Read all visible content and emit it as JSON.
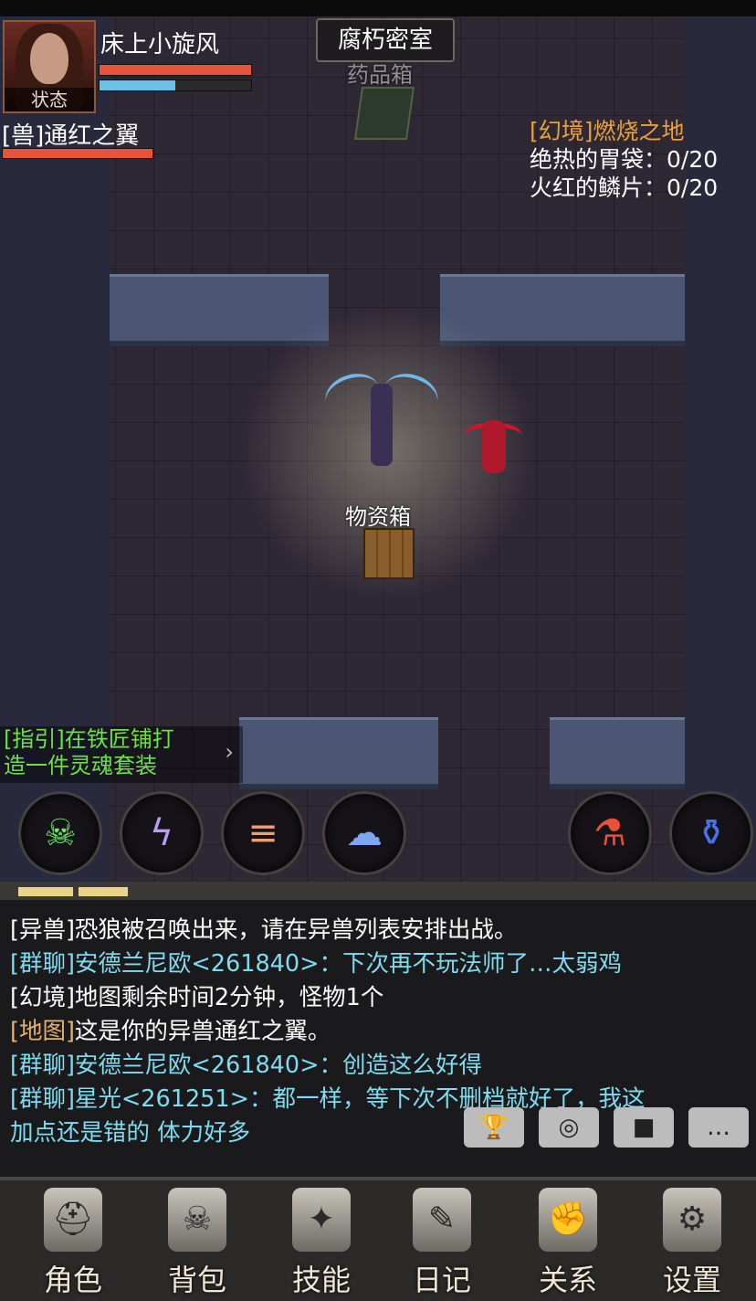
{
  "map": {
    "title": "腐朽密室",
    "chest_label": "药品箱",
    "crate_label": "物资箱"
  },
  "player": {
    "name": "床上小旋风",
    "status_label": "状态",
    "hp_ratio": 1.0,
    "mp_ratio": 0.5
  },
  "pet": {
    "name": "[兽]通红之翼",
    "hp_ratio": 1.0
  },
  "quest": {
    "title": "[幻境]燃烧之地",
    "items": [
      {
        "name": "绝热的胃袋",
        "sep": "：",
        "progress": "0/20"
      },
      {
        "name": "火红的鳞片",
        "sep": "：",
        "progress": "0/20"
      }
    ]
  },
  "guide": {
    "line1": "[指引]在铁匠铺打",
    "line2": "造一件灵魂套装",
    "chevron": "›"
  },
  "skills": [
    {
      "icon": "poison-skull-icon",
      "glyph": "☠"
    },
    {
      "icon": "lightning-orb-icon",
      "glyph": "ϟ"
    },
    {
      "icon": "triple-slash-icon",
      "glyph": "≡"
    },
    {
      "icon": "storm-cloud-icon",
      "glyph": "☁"
    }
  ],
  "potions": [
    {
      "icon": "red-potion-icon",
      "glyph": "⚗"
    },
    {
      "icon": "blue-potion-icon",
      "glyph": "⚱"
    }
  ],
  "chat": {
    "lines": [
      {
        "tag": "[异兽]",
        "text": "恐狼被召唤出来，请在异兽列表安排出战。",
        "color": "#ffffff",
        "tag_color": "#ffffff"
      },
      {
        "tag": "[群聊]",
        "text": "安德兰尼欧<261840>：下次再不玩法师了…太弱鸡",
        "color": "#7fdcf0",
        "tag_color": "#7fdcf0"
      },
      {
        "tag": "[幻境]",
        "text": "地图剩余时间2分钟，怪物1个",
        "color": "#ffffff",
        "tag_color": "#ffffff"
      },
      {
        "tag": "[地图]",
        "text": "这是你的异兽通红之翼。",
        "color": "#ffffff",
        "tag_color": "#e6b070"
      },
      {
        "tag": "[群聊]",
        "text": "安德兰尼欧<261840>：创造这么好得",
        "color": "#7fdcf0",
        "tag_color": "#7fdcf0"
      },
      {
        "tag": "[群聊]",
        "text": "星光<261251>：都一样，等下次不删档就好了，我这",
        "color": "#7fdcf0",
        "tag_color": "#7fdcf0"
      },
      {
        "tag": "",
        "text": "加点还是错的  体力好多",
        "color": "#7fdcf0",
        "tag_color": "#7fdcf0"
      }
    ]
  },
  "chat_buttons": [
    {
      "icon": "trophy-icon",
      "glyph": "🏆"
    },
    {
      "icon": "compass-icon",
      "glyph": "◎"
    },
    {
      "icon": "stop-icon",
      "glyph": "■"
    },
    {
      "icon": "chat-bubble-icon",
      "glyph": "…"
    }
  ],
  "nav": [
    {
      "label": "角色",
      "icon": "helmet-icon",
      "glyph": "⛑"
    },
    {
      "label": "背包",
      "icon": "backpack-icon",
      "glyph": "☠"
    },
    {
      "label": "技能",
      "icon": "spellbook-icon",
      "glyph": "✦"
    },
    {
      "label": "日记",
      "icon": "scroll-icon",
      "glyph": "✎"
    },
    {
      "label": "关系",
      "icon": "handshake-icon",
      "glyph": "✊"
    },
    {
      "label": "设置",
      "icon": "gear-icon",
      "glyph": "⚙"
    }
  ],
  "colors": {
    "hp": "#e8533c",
    "mp": "#6fc0e6",
    "pet_hp": "#e8533c",
    "quest_title": "#e8a13c",
    "guide": "#6de04a"
  }
}
